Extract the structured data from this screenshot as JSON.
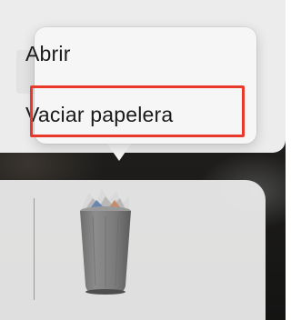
{
  "context_menu": {
    "items": [
      {
        "label": "Abrir"
      },
      {
        "label": "Vaciar papelera"
      }
    ]
  },
  "dock": {
    "items": [
      {
        "icon": "trash-full-icon"
      }
    ]
  },
  "highlight": {
    "target": "Vaciar papelera",
    "color": "#e8392c"
  }
}
